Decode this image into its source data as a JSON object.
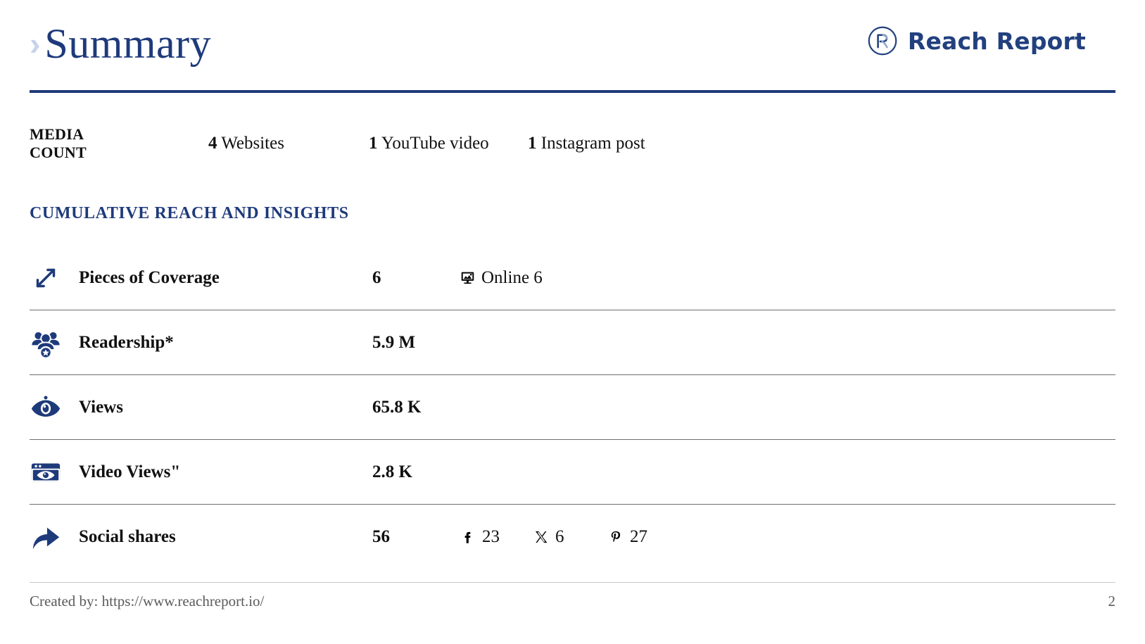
{
  "header": {
    "chevron": "›",
    "title": "Summary",
    "brand_name": "Reach Report",
    "brand_mark_icon": "reach-report-logo-icon",
    "accent_color": "#1e3a7b",
    "chevron_color": "#c7d3ea"
  },
  "media_count": {
    "label_line1": "MEDIA",
    "label_line2": "COUNT",
    "items": [
      {
        "count": "4",
        "label": "Websites"
      },
      {
        "count": "1",
        "label": "YouTube video"
      },
      {
        "count": "1",
        "label": "Instagram post"
      }
    ]
  },
  "section": {
    "heading": "CUMULATIVE REACH AND INSIGHTS"
  },
  "metrics": [
    {
      "icon": "diagonal-expand-arrow-icon",
      "label": "Pieces of Coverage",
      "value": "6",
      "extras": [
        {
          "icon": "online-monitor-icon",
          "text": "Online 6"
        }
      ]
    },
    {
      "icon": "group-people-icon",
      "label": "Readership*",
      "value": "5.9 M",
      "extras": []
    },
    {
      "icon": "eye-icon",
      "label": "Views",
      "value": "65.8 K",
      "extras": []
    },
    {
      "icon": "video-window-eye-icon",
      "label": "Video Views\"",
      "value": "2.8 K",
      "extras": []
    },
    {
      "icon": "share-arrow-icon",
      "label": "Social shares",
      "value": "56",
      "extras": [
        {
          "icon": "facebook-icon",
          "text": "23"
        },
        {
          "icon": "x-twitter-icon",
          "text": "6"
        },
        {
          "icon": "pinterest-icon",
          "text": "27"
        }
      ]
    }
  ],
  "footer": {
    "created_by": "Created by: https://www.reachreport.io/",
    "page_number": "2"
  }
}
